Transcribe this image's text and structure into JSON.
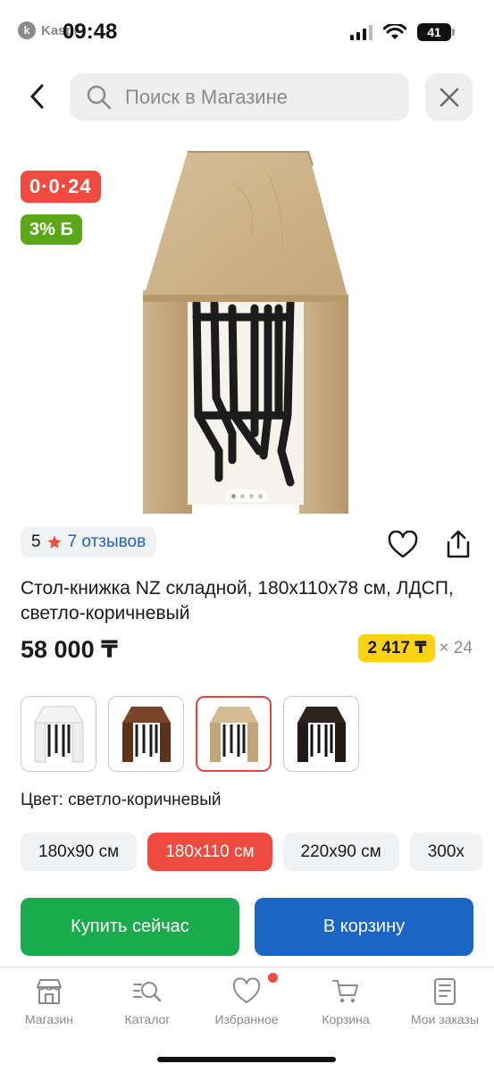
{
  "status_bar": {
    "app_name": "Kaspi",
    "time": "09:48",
    "battery": "41"
  },
  "search": {
    "placeholder": "Поиск в Магазине"
  },
  "badges": {
    "timer": "0·0·24",
    "bonus": "3% Б"
  },
  "rating": {
    "score": "5",
    "reviews": "7 отзывов"
  },
  "product": {
    "title": "Стол-книжка NZ складной, 180x110x78 см, ЛДСП, светло-коричневый",
    "price": "58 000 ₸",
    "installment_amount": "2 417 ₸",
    "installment_multiplier": "× 24",
    "color_label": "Цвет: светло-коричневый"
  },
  "colors": [
    {
      "name": "white",
      "swatch": "#f4f4f4"
    },
    {
      "name": "walnut",
      "swatch": "#6b3a22"
    },
    {
      "name": "light-brown",
      "swatch": "#c8ab82",
      "selected": true
    },
    {
      "name": "black",
      "swatch": "#2a1f1a"
    }
  ],
  "sizes": [
    {
      "label": "180x90 см"
    },
    {
      "label": "180x110 см",
      "selected": true
    },
    {
      "label": "220x90 см"
    },
    {
      "label": "300x"
    }
  ],
  "actions": {
    "buy_now": "Купить сейчас",
    "to_cart": "В корзину"
  },
  "tabbar": [
    {
      "label": "Магазин",
      "icon": "shop-icon"
    },
    {
      "label": "Каталог",
      "icon": "catalog-search-icon"
    },
    {
      "label": "Избранное",
      "icon": "heart-icon"
    },
    {
      "label": "Корзина",
      "icon": "cart-icon"
    },
    {
      "label": "Мои заказы",
      "icon": "orders-icon"
    }
  ],
  "theme": {
    "red": "#f04b3e",
    "green": "#1aab4c",
    "blue": "#1a66c4",
    "yellow": "#ffd314",
    "bonus_green": "#5aa817"
  }
}
